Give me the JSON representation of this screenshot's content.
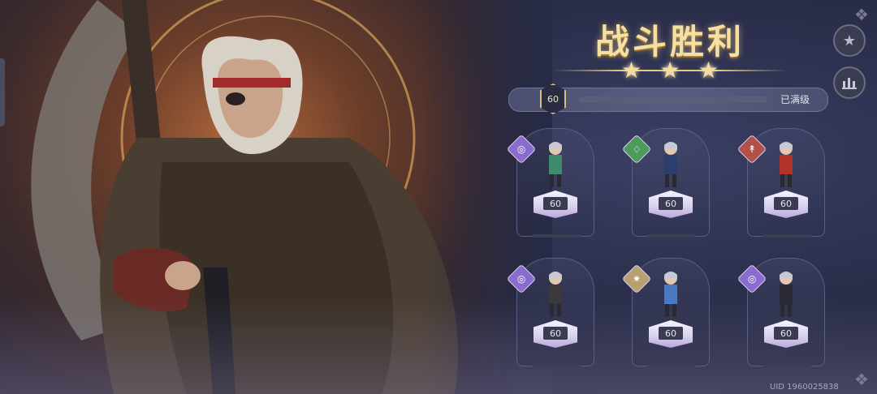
{
  "title": "战斗胜利",
  "stars_earned": 3,
  "stars": [
    "★",
    "★",
    "★"
  ],
  "side_buttons": {
    "favorite_icon": "★",
    "stats_icon": "▁▃▁"
  },
  "account_level": {
    "level": "60",
    "status": "已满级",
    "progress": 1.0
  },
  "heroes": [
    {
      "element": "psychic",
      "element_color": "#8a6ccf",
      "element_glyph": "◎",
      "level": "60",
      "outfit": "#3f8a6c"
    },
    {
      "element": "nature",
      "element_color": "#4e9a5a",
      "element_glyph": "♢",
      "level": "60",
      "outfit": "#2a3f6b"
    },
    {
      "element": "fire",
      "element_color": "#b2504a",
      "element_glyph": "↟",
      "level": "60",
      "outfit": "#b2322a"
    },
    {
      "element": "psychic",
      "element_color": "#8a6ccf",
      "element_glyph": "◎",
      "level": "60",
      "outfit": "#3a3a3e"
    },
    {
      "element": "light",
      "element_color": "#b8a070",
      "element_glyph": "✷",
      "level": "60",
      "outfit": "#4a78c2"
    },
    {
      "element": "psychic",
      "element_color": "#8a6ccf",
      "element_glyph": "◎",
      "level": "60",
      "outfit": "#2a2a34"
    }
  ],
  "uid": "UID 1960025838",
  "colors": {
    "accent_gold": "#f6dfa3",
    "panel": "#262a45"
  }
}
